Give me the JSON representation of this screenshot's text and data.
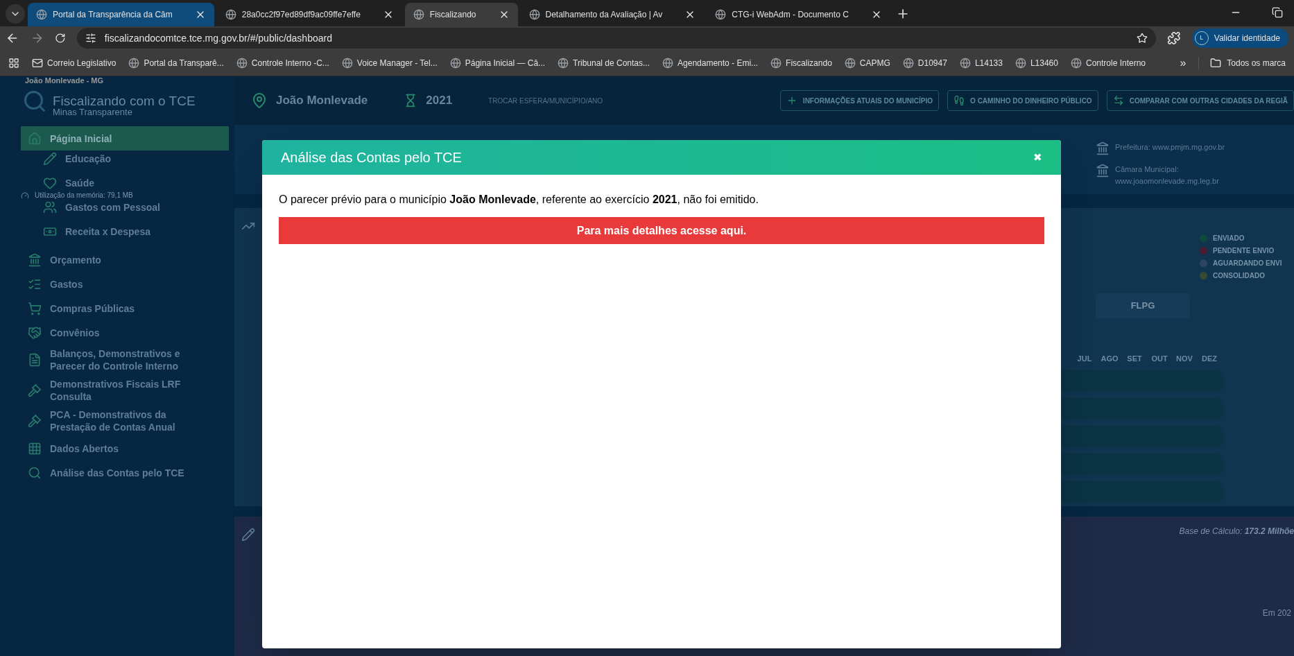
{
  "browser": {
    "tabs": [
      {
        "title": "Portal da Transparência da Câm",
        "selected": false,
        "grouped": true
      },
      {
        "title": "28a0cc2f97ed89df9ac09ffe7effe",
        "selected": false,
        "grouped": false
      },
      {
        "title": "Fiscalizando",
        "selected": true,
        "grouped": false
      },
      {
        "title": "Detalhamento da Avaliação | Av",
        "selected": false,
        "grouped": false
      },
      {
        "title": "CTG-i WebAdm - Documento C",
        "selected": false,
        "grouped": false
      }
    ],
    "url": "fiscalizandocomtce.tce.mg.gov.br/#/public/dashboard",
    "profile": {
      "initial": "L",
      "label": "Validar identidade"
    },
    "bookmarks": [
      "Correio Legislativo",
      "Portal da Transparê...",
      "Controle Interno -C...",
      "Voice Manager - Tel...",
      "Página Inicial — Câ...",
      "Tribunal de Contas...",
      "Agendamento - Emi...",
      "Fiscalizando",
      "CAPMG",
      "D10947",
      "L14133",
      "L13460",
      "Controle Interno"
    ],
    "more": "»",
    "all_bookmarks": "Todos os marca",
    "hover_card": {
      "subtitle": "João Monlevade - MG",
      "memory": "Utilização da memória: 79,1 MB"
    }
  },
  "sidebar": {
    "title": "Fiscalizando com o TCE",
    "subtitle": "Minas Transparente",
    "items": [
      {
        "label": "Página Inicial",
        "selected": true,
        "children": [
          {
            "label": "Educação",
            "selected": false
          },
          {
            "label": "Saúde",
            "selected": false
          },
          {
            "label": "Gastos com Pessoal",
            "selected": false
          },
          {
            "label": "Receita x Despesa",
            "selected": false
          }
        ]
      },
      {
        "label": "Orçamento",
        "selected": false
      },
      {
        "label": "Gastos",
        "selected": false
      },
      {
        "label": "Compras Públicas",
        "selected": false
      },
      {
        "label": "Convênios",
        "selected": false
      },
      {
        "label": "Balanços, Demonstrativos e Parecer do Controle Interno",
        "selected": false
      },
      {
        "label": "Demonstrativos Fiscais LRF Consulta",
        "selected": false
      },
      {
        "label": "PCA - Demonstrativos da Prestação de Contas Anual",
        "selected": false
      },
      {
        "label": "Dados Abertos",
        "selected": false
      },
      {
        "label": "Análise das Contas pelo TCE",
        "selected": false
      }
    ]
  },
  "header": {
    "municipality": "João Monlevade",
    "year": "2021",
    "change": "TROCAR ESFERA/MUNICÍPIO/ANO",
    "buttons": [
      "INFORMAÇÕES ATUAIS DO MUNICÍPIO",
      "O CAMINHO DO DINHEIRO PÚBLICO",
      "COMPARAR COM OUTRAS CIDADES DA REGIÃ"
    ]
  },
  "info": {
    "prefeitura": "Prefeitura: www.pmjm.mg.gov.br",
    "camara": "Câmara Municipal: www.joaomonlevade.mg.leg.br"
  },
  "legend": [
    {
      "label": "ENVIADO",
      "color": "#0d4a3c"
    },
    {
      "label": "PENDENTE ENVIO",
      "color": "#4a1c33"
    },
    {
      "label": "AGUARDANDO ENVI",
      "color": "#2b4661"
    },
    {
      "label": "CONSOLIDADO",
      "color": "#374a33"
    }
  ],
  "report_tab": "FLPG",
  "months": [
    "JUL",
    "AGO",
    "SET",
    "OUT",
    "NOV",
    "DEZ"
  ],
  "base": {
    "label": "Base de Cálculo:",
    "value": "173.2 Milhõe"
  },
  "year_note": "Em 202",
  "modal": {
    "title": "Análise das Contas pelo TCE",
    "close": "✖",
    "message": "O parecer prévio para o município **João Monlevade**, referente ao exercício **2021**, não foi emitido.",
    "button": "Para mais detalhes acesse aqui."
  }
}
